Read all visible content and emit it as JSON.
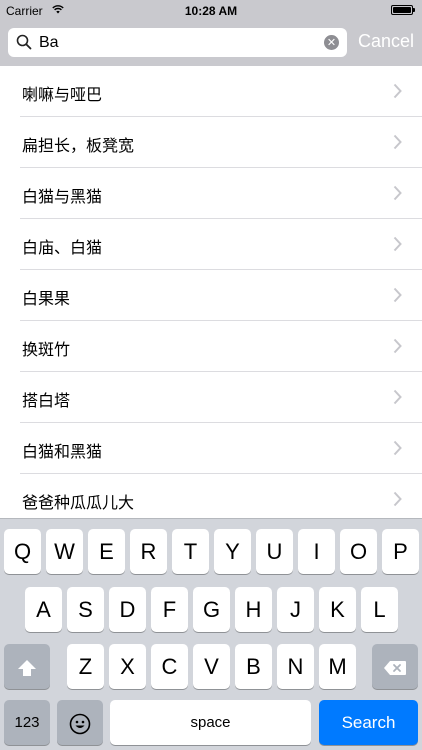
{
  "status_bar": {
    "carrier": "Carrier",
    "time": "10:28 AM",
    "battery_level": 1.0,
    "icons": [
      "wifi-icon",
      "battery-icon"
    ]
  },
  "search": {
    "value": "Ba",
    "cancel_label": "Cancel",
    "icons": [
      "search-icon",
      "clear-icon"
    ]
  },
  "results": [
    "喇嘛与哑巴",
    "扁担长，板凳宽",
    "白猫与黑猫",
    "白庙、白猫",
    "白果果",
    "换斑竹",
    "搭白塔",
    "白猫和黑猫",
    "爸爸种瓜瓜儿大"
  ],
  "keyboard": {
    "row1": [
      "Q",
      "W",
      "E",
      "R",
      "T",
      "Y",
      "U",
      "I",
      "O",
      "P"
    ],
    "row2": [
      "A",
      "S",
      "D",
      "F",
      "G",
      "H",
      "J",
      "K",
      "L"
    ],
    "row3": [
      "Z",
      "X",
      "C",
      "V",
      "B",
      "N",
      "M"
    ],
    "numbers_label": "123",
    "space_label": "space",
    "search_label": "Search",
    "icons": [
      "shift-icon",
      "delete-icon",
      "emoji-icon"
    ]
  },
  "colors": {
    "search_bar_bg": "#c9c9ce",
    "keyboard_bg": "#d2d5db",
    "search_key": "#007aff",
    "chevron": "#c7c7cc"
  }
}
